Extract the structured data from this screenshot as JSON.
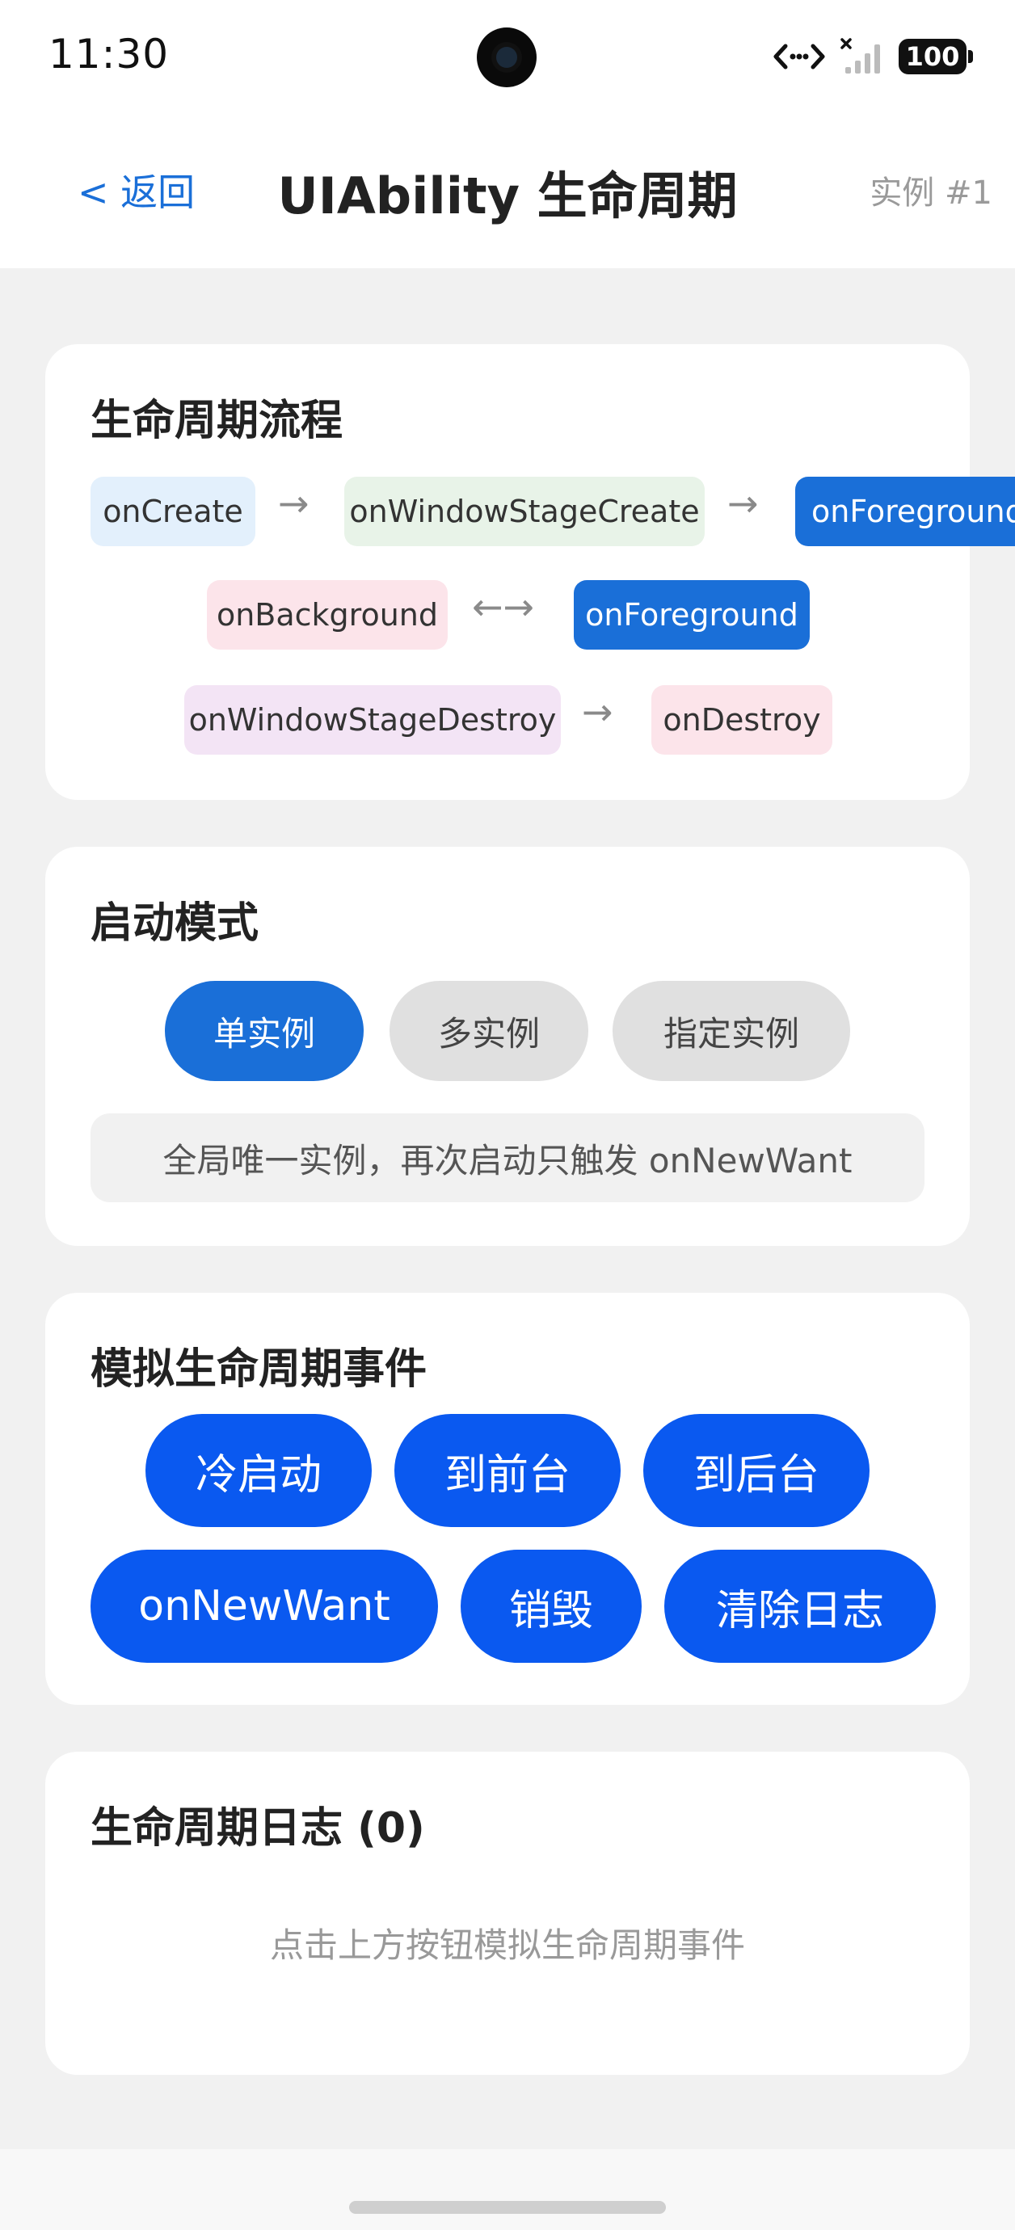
{
  "status": {
    "time": "11:30",
    "battery": "100",
    "icons": [
      "camera-icon",
      "data-transfer-icon",
      "signal-icon",
      "battery-icon"
    ]
  },
  "header": {
    "back_label": "< 返回",
    "title": "UIAbility 生命周期",
    "instance_label": "实例 #1"
  },
  "flow": {
    "title": "生命周期流程",
    "row1": [
      "onCreate",
      "onWindowStageCreate",
      "onForeground"
    ],
    "row2": [
      "onBackground",
      "onForeground"
    ],
    "row3": [
      "onWindowStageDestroy",
      "onDestroy"
    ],
    "arrow_single": "→",
    "arrow_double": "←→"
  },
  "launch_mode": {
    "title": "启动模式",
    "options": [
      "单实例",
      "多实例",
      "指定实例"
    ],
    "selected": "单实例",
    "description": "全局唯一实例，再次启动只触发 onNewWant"
  },
  "simulate": {
    "title": "模拟生命周期事件",
    "buttons": [
      "冷启动",
      "到前台",
      "到后台",
      "onNewWant",
      "销毁",
      "清除日志"
    ]
  },
  "log": {
    "title": "生命周期日志 (0)",
    "empty_text": "点击上方按钮模拟生命周期事件"
  },
  "colors": {
    "accent": "#1a6fd8",
    "action_button": "#0a59f0",
    "page_bg": "#f1f1f1"
  }
}
